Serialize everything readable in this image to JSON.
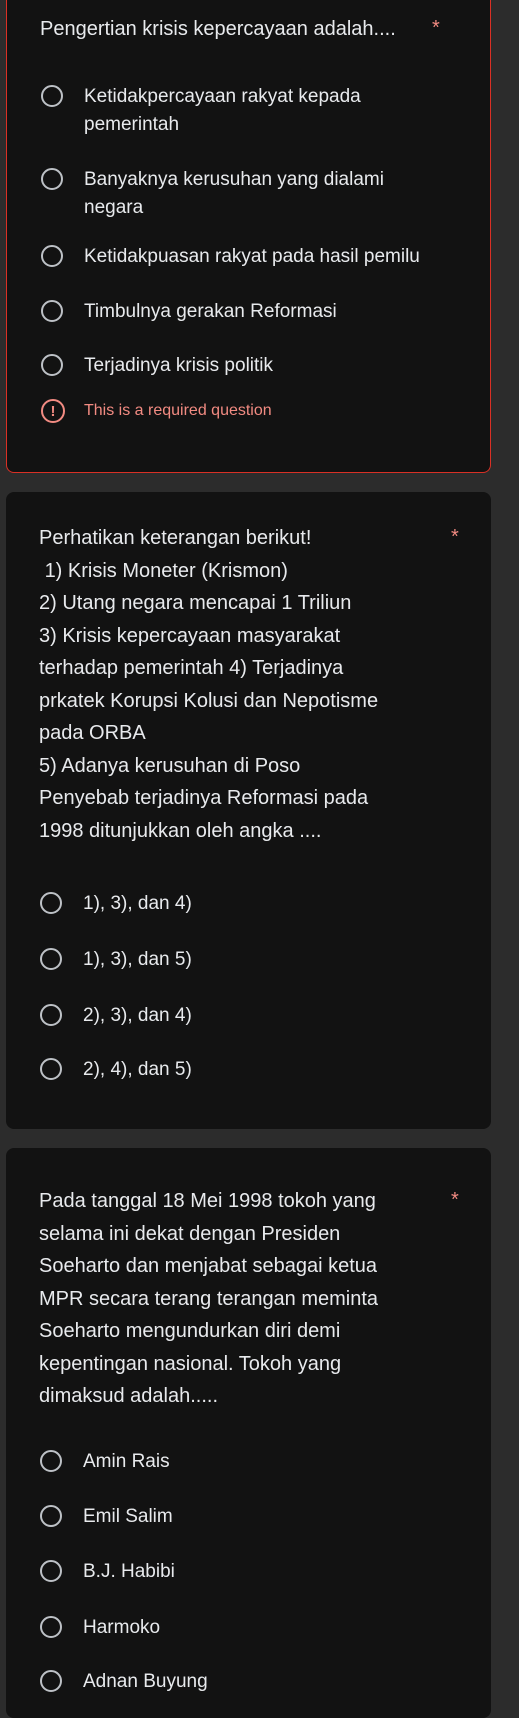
{
  "q1": {
    "title": "Pengertian krisis kepercayaan adalah....",
    "required_mark": "*",
    "options": [
      "Ketidakpercayaan rakyat kepada pemerintah",
      "Banyaknya kerusuhan yang dialami negara",
      "Ketidakpuasan rakyat pada hasil pemilu",
      "Timbulnya gerakan Reformasi",
      "Terjadinya krisis politik"
    ],
    "error": "This is a required question"
  },
  "q2": {
    "title": "Perhatikan keterangan berikut!\n 1) Krisis Moneter (Krismon)\n2) Utang negara mencapai 1 Triliun\n3) Krisis kepercayaan masyarakat terhadap pemerintah 4) Terjadinya prkatek Korupsi Kolusi dan Nepotisme pada ORBA\n5) Adanya kerusuhan di Poso\nPenyebab terjadinya Reformasi pada 1998 ditunjukkan oleh angka ....",
    "required_mark": "*",
    "options": [
      "1), 3), dan 4)",
      "1), 3), dan 5)",
      "2), 3), dan 4)",
      "2), 4), dan 5)"
    ]
  },
  "q3": {
    "title": "Pada tanggal 18 Mei 1998 tokoh yang selama ini dekat dengan Presiden Soeharto dan menjabat sebagai ketua MPR secara terang terangan meminta Soeharto mengundurkan diri demi kepentingan nasional. Tokoh yang dimaksud adalah.....",
    "required_mark": "*",
    "options": [
      "Amin Rais",
      "Emil Salim",
      "B.J. Habibi",
      "Harmoko",
      "Adnan Buyung"
    ]
  },
  "colors": {
    "background": "#2c2c2c",
    "card": "#121212",
    "error": "#f28b82",
    "error_border": "#d93025"
  }
}
